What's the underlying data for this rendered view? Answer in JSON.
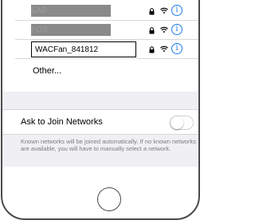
{
  "networks": [
    {
      "name": "EAB",
      "obscured": true
    },
    {
      "name": "FOS",
      "obscured": true
    },
    {
      "name": "WACFan_841812",
      "obscured": false,
      "selected": true
    }
  ],
  "other_label": "Other...",
  "ask_to_join": {
    "label": "Ask to Join Networks",
    "enabled": false,
    "note": "Known networks will be joined automatically. If no known networks are available, you will have to manually select a network."
  },
  "icons": {
    "lock": "lock-icon",
    "wifi": "wifi-icon",
    "info": "info-icon",
    "info_glyph": "i"
  },
  "colors": {
    "accent": "#1e7cf0",
    "group_background": "#efeff4",
    "separator": "#d8d8dc",
    "footer_text": "#7b7b80"
  }
}
